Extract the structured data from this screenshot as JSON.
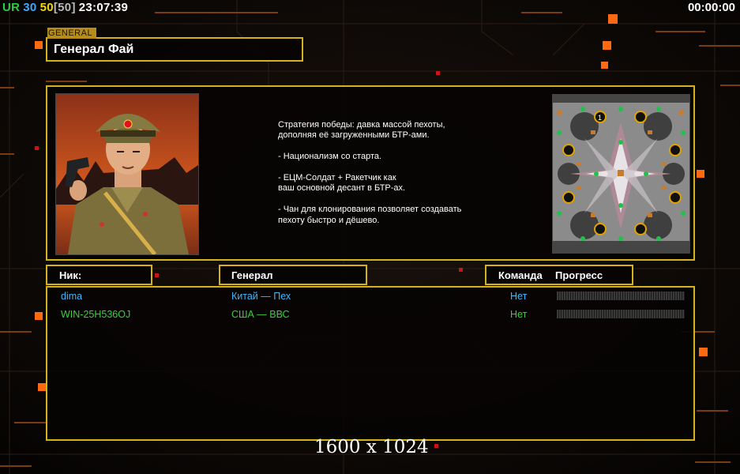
{
  "hud": {
    "tag": "UR",
    "val1": "30",
    "val2": "50",
    "val3": "[50]",
    "clock": "23:07:39",
    "timer": "00:00:00",
    "colors": {
      "tag": "#2ecc40",
      "val1": "#3fa9ff",
      "val2": "#f5d90a",
      "val3": "#b9b9b9"
    }
  },
  "general": {
    "tab_label": "GENERAL",
    "title": "Генерал Фай",
    "description": "Стратегия победы: давка массой пехоты,\n дополняя её загруженными БТР-ами.\n\n- Национализм со старта.\n\n- ЕЦМ-Солдат + Ракетчик как\nваш основной десант в БТР-ах.\n\n- Чан для клонирования позволяет создавать\n пехоту быстро и дёшево."
  },
  "headers": {
    "nick": "Ник:",
    "general": "Генерал",
    "team": "Команда",
    "progress": "Прогресс"
  },
  "players": [
    {
      "nick": "dima",
      "general": "Китай — Пех",
      "team": "Нет",
      "color": "#3fb6ff"
    },
    {
      "nick": "WIN-25H536OJ",
      "general": "США — ВВС",
      "team": "Нет",
      "color": "#3bcf3b"
    }
  ],
  "minimap": {
    "start_label": "1"
  },
  "watermark": "1600 x 1024"
}
